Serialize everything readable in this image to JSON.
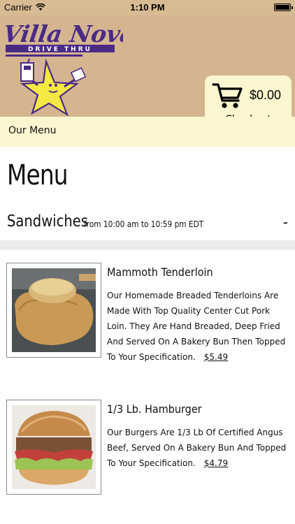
{
  "status_bar": {
    "carrier": "Carrier",
    "time": "1:10 PM"
  },
  "brand": {
    "name": "Villa Nova",
    "tagline": "DRIVE THRU"
  },
  "cart": {
    "amount": "$0.00",
    "checkout_label": "Checkout"
  },
  "nav": {
    "label": "Our Menu"
  },
  "page": {
    "title": "Menu"
  },
  "section": {
    "name": "Sandwiches",
    "hours": "from 10:00 am to 10:59 pm EDT",
    "toggle": "-"
  },
  "items": [
    {
      "name": "Mammoth Tenderloin",
      "description": "Our Homemade Breaded Tenderloins Are Made With Top Quality Center Cut Pork Loin. They Are Hand Breaded, Deep Fried And Served On A Bakery Bun Then Topped To Your Specification.",
      "price": "$5.49"
    },
    {
      "name": "1/3 Lb. Hamburger",
      "description": "Our Burgers Are 1/3 Lb Of Certified Angus Beef, Served On A Bakery Bun And Topped To Your Specification.",
      "price": "$4.79"
    }
  ],
  "colors": {
    "header_tan": "#d4b590",
    "cream": "#fbf6cf",
    "logo_purple": "#4b2a86",
    "logo_yellow": "#f4e842"
  }
}
